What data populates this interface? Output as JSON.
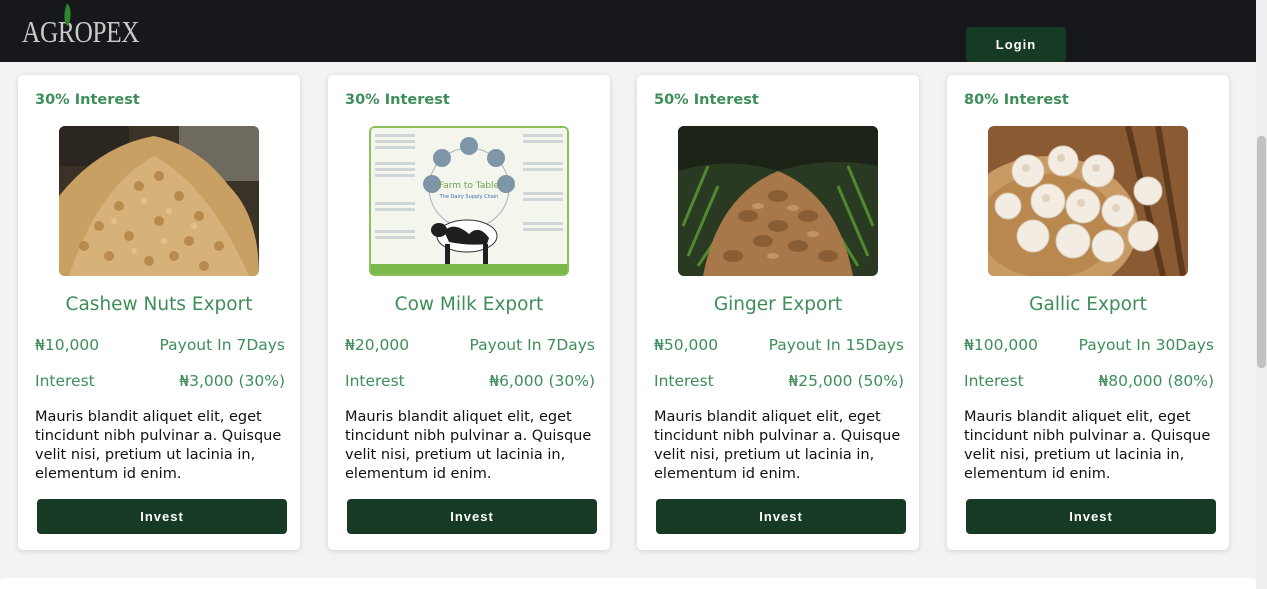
{
  "header": {
    "logo_text": "AGROPEX",
    "login_label": "Login"
  },
  "colors": {
    "header_bg": "#17181b",
    "accent_green": "#3e8e5a",
    "button_green": "#173a24",
    "logo_leaf": "#2f8a2f"
  },
  "cards": [
    {
      "rate": "30% Interest",
      "image_alt": "cashew-nuts-photo",
      "title": "Cashew Nuts Export",
      "price": "₦10,000",
      "payout": "Payout In 7Days",
      "interest_label": "Interest",
      "interest_value": "₦3,000 (30%)",
      "description": "Mauris blandit aliquet elit, eget tincidunt nibh pulvinar a. Quisque velit nisi, pretium ut lacinia in, elementum id enim.",
      "button_label": "Invest"
    },
    {
      "rate": "30% Interest",
      "image_alt": "farm-to-table-dairy-chain-diagram",
      "title": "Cow Milk Export",
      "price": "₦20,000",
      "payout": "Payout In 7Days",
      "interest_label": "Interest",
      "interest_value": "₦6,000 (30%)",
      "description": "Mauris blandit aliquet elit, eget tincidunt nibh pulvinar a. Quisque velit nisi, pretium ut lacinia in, elementum id enim.",
      "button_label": "Invest"
    },
    {
      "rate": "50% Interest",
      "image_alt": "ginger-photo",
      "title": "Ginger Export",
      "price": "₦50,000",
      "payout": "Payout In 15Days",
      "interest_label": "Interest",
      "interest_value": "₦25,000 (50%)",
      "description": "Mauris blandit aliquet elit, eget tincidunt nibh pulvinar a. Quisque velit nisi, pretium ut lacinia in, elementum id enim.",
      "button_label": "Invest"
    },
    {
      "rate": "80% Interest",
      "image_alt": "garlic-photo",
      "title": "Gallic Export",
      "price": "₦100,000",
      "payout": "Payout In 30Days",
      "interest_label": "Interest",
      "interest_value": "₦80,000 (80%)",
      "description": "Mauris blandit aliquet elit, eget tincidunt nibh pulvinar a. Quisque velit nisi, pretium ut lacinia in, elementum id enim.",
      "button_label": "Invest"
    }
  ]
}
